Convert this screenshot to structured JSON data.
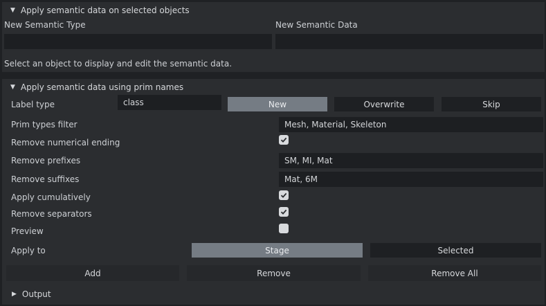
{
  "section1": {
    "title": "Apply semantic data on selected objects",
    "type_label": "New Semantic Type",
    "data_label": "New Semantic Data",
    "type_value": "",
    "data_value": "",
    "info": "Select an object to display and edit the semantic data."
  },
  "section2": {
    "title": "Apply semantic data using prim names",
    "label_type": {
      "label": "Label type",
      "value": "class",
      "buttons": [
        "New",
        "Overwrite",
        "Skip"
      ],
      "active": "New"
    },
    "prim_types_filter": {
      "label": "Prim types filter",
      "value": "Mesh, Material, Skeleton"
    },
    "remove_numerical_ending": {
      "label": "Remove numerical ending",
      "checked": true
    },
    "remove_prefixes": {
      "label": "Remove prefixes",
      "value": "SM, MI, Mat"
    },
    "remove_suffixes": {
      "label": "Remove suffixes",
      "value": "Mat, 6M"
    },
    "apply_cumulatively": {
      "label": "Apply cumulatively",
      "checked": true
    },
    "remove_separators": {
      "label": "Remove separators",
      "checked": true
    },
    "preview": {
      "label": "Preview",
      "checked": false
    },
    "apply_to": {
      "label": "Apply to",
      "buttons": [
        "Stage",
        "Selected"
      ],
      "active": "Stage"
    },
    "actions": {
      "add": "Add",
      "remove": "Remove",
      "remove_all": "Remove All"
    }
  },
  "output": {
    "title": "Output"
  },
  "colors": {
    "active_button": "#757c84",
    "panel": "#2b2d30",
    "field": "#1d1f22"
  }
}
